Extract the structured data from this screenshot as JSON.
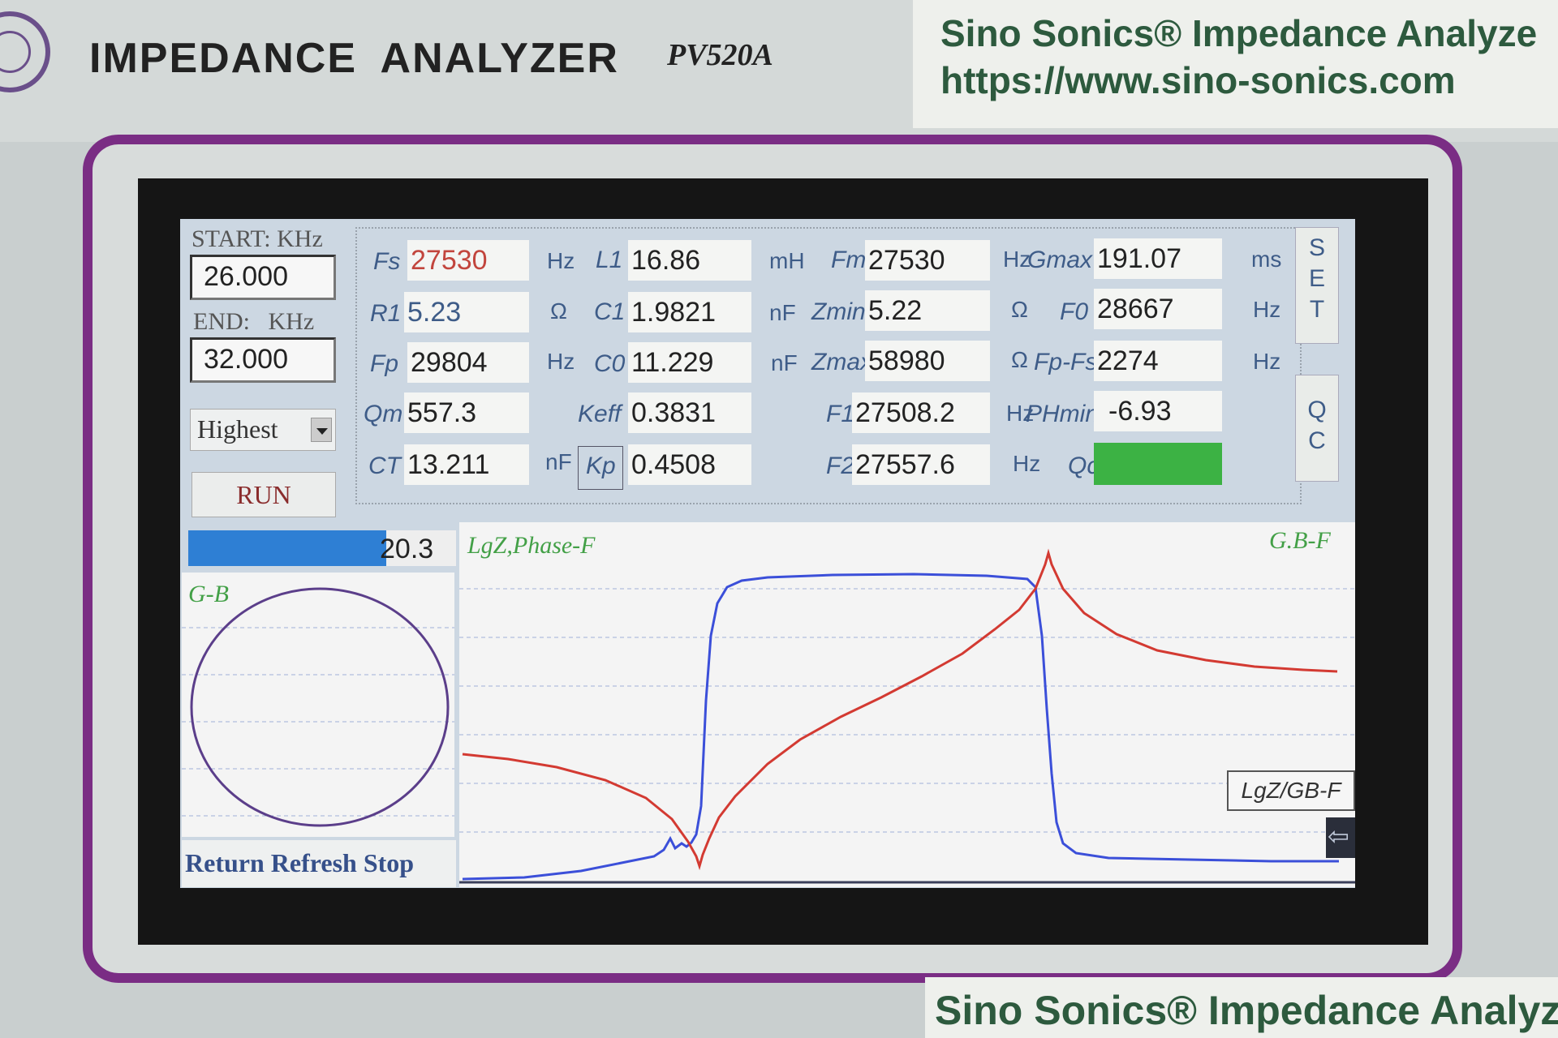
{
  "device": {
    "title": "IMPEDANCE ANALYZER",
    "model": "PV520A",
    "label_line1": "Sino Sonics® Impedance Analyze",
    "label_line2": "https://www.sino-sonics.com",
    "label_bottom": "Sino Sonics® Impedance Analyz"
  },
  "sweep": {
    "start_label": "START: KHz",
    "start_value": "26.000",
    "end_label": "END:   KHz",
    "end_value": "32.000",
    "precision": "Highest",
    "run_label": "RUN",
    "progress_value": "20.3",
    "progress_fraction": 0.74
  },
  "params": {
    "fs": {
      "label": "Fs",
      "value": "27530",
      "unit": "Hz"
    },
    "r1": {
      "label": "R1",
      "value": "5.23",
      "unit": "Ω"
    },
    "fp": {
      "label": "Fp",
      "value": "29804",
      "unit": "Hz"
    },
    "qm": {
      "label": "Qm",
      "value": "557.3"
    },
    "ct": {
      "label": "CT",
      "value": "13.211",
      "unit": "nF"
    },
    "l1": {
      "label": "L1",
      "value": "16.86",
      "unit": "mH"
    },
    "c1": {
      "label": "C1",
      "value": "1.9821",
      "unit": "nF"
    },
    "c0": {
      "label": "C0",
      "value": "11.229",
      "unit": "nF"
    },
    "keff": {
      "label": "Keff",
      "value": "0.3831"
    },
    "kp": {
      "label": "Kp",
      "value": "0.4508"
    },
    "fm": {
      "label": "Fm",
      "value": "27530",
      "unit": "Hz"
    },
    "zmin": {
      "label": "Zmin",
      "value": "5.22",
      "unit": "Ω"
    },
    "zmax": {
      "label": "Zmax",
      "value": "58980",
      "unit": "Ω"
    },
    "f1": {
      "label": "F1",
      "value": "27508.2",
      "unit": "Hz"
    },
    "f2": {
      "label": "F2",
      "value": "27557.6",
      "unit": "Hz"
    },
    "gmax": {
      "label": "Gmax",
      "value": "191.07",
      "unit": "ms"
    },
    "f0": {
      "label": "F0",
      "value": "28667",
      "unit": "Hz"
    },
    "fpfs": {
      "label": "Fp-Fs",
      "value": "2274",
      "unit": "Hz"
    },
    "phmin": {
      "label": "PHmin",
      "value": "-6.93"
    },
    "qc": {
      "label": "Qc",
      "status_color": "#3cb244"
    }
  },
  "buttons": {
    "set_s": "S",
    "set_e": "E",
    "set_t": "T",
    "qc_q": "Q",
    "qc_c": "C",
    "nav": "Return Refresh Stop",
    "mode": "LgZ/GB-F",
    "back_icon": "back-arrow-icon"
  },
  "plots": {
    "gb_label": "G-B",
    "main_label": "LgZ,Phase-F",
    "right_label": "G.B-F"
  },
  "colors": {
    "impedance_curve": "#d33a32",
    "phase_curve": "#3b4fd9",
    "gb_circle": "#5b3e8a",
    "qc_ok": "#3cb244"
  }
}
